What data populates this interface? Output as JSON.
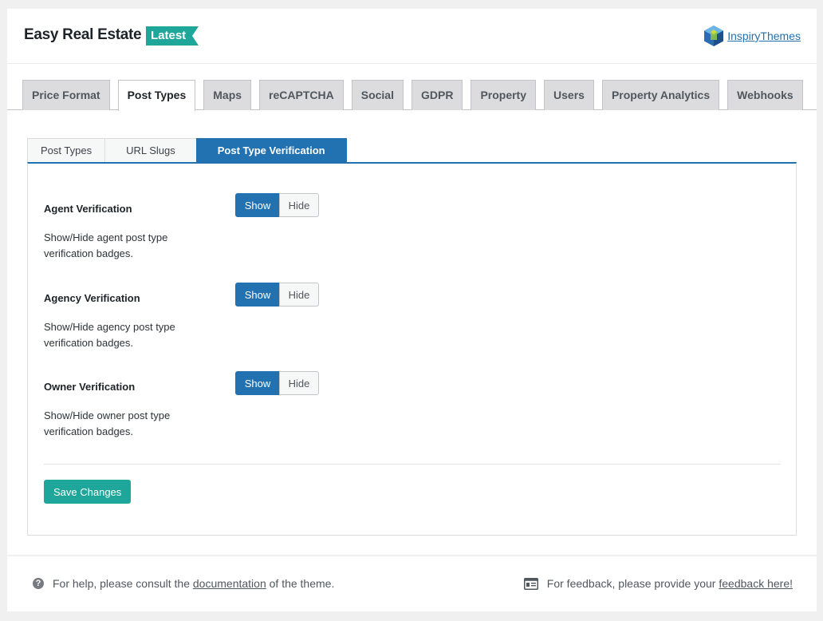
{
  "header": {
    "title": "Easy Real Estate",
    "badge": "Latest",
    "brand_link": "InspiryThemes"
  },
  "main_tabs": [
    {
      "label": "Price Format",
      "active": false
    },
    {
      "label": "Post Types",
      "active": true
    },
    {
      "label": "Maps",
      "active": false
    },
    {
      "label": "reCAPTCHA",
      "active": false
    },
    {
      "label": "Social",
      "active": false
    },
    {
      "label": "GDPR",
      "active": false
    },
    {
      "label": "Property",
      "active": false
    },
    {
      "label": "Users",
      "active": false
    },
    {
      "label": "Property Analytics",
      "active": false
    },
    {
      "label": "Webhooks",
      "active": false
    }
  ],
  "sub_tabs": [
    {
      "label": "Post Types",
      "active": false
    },
    {
      "label": "URL Slugs",
      "active": false
    },
    {
      "label": "Post Type Verification",
      "active": true
    }
  ],
  "settings": [
    {
      "label": "Agent Verification",
      "description": "Show/Hide agent post type verification badges.",
      "show_label": "Show",
      "hide_label": "Hide",
      "selected": "Show"
    },
    {
      "label": "Agency Verification",
      "description": "Show/Hide agency post type verification badges.",
      "show_label": "Show",
      "hide_label": "Hide",
      "selected": "Show"
    },
    {
      "label": "Owner Verification",
      "description": "Show/Hide owner post type verification badges.",
      "show_label": "Show",
      "hide_label": "Hide",
      "selected": "Show"
    }
  ],
  "save_label": "Save Changes",
  "footer": {
    "help_prefix": "For help, please consult the",
    "help_link": "documentation",
    "help_suffix": "of the theme.",
    "feedback_prefix": "For feedback, please provide your",
    "feedback_link": "feedback here!"
  },
  "colors": {
    "accent": "#2271b1",
    "brand": "#1ea69a"
  }
}
